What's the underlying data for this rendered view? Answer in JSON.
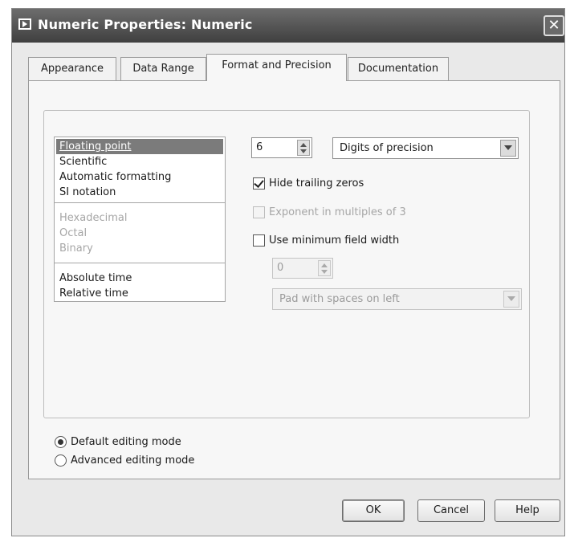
{
  "window": {
    "title": "Numeric Properties: Numeric",
    "close_glyph": "✕"
  },
  "tabs": [
    {
      "label": "Appearance"
    },
    {
      "label": "Data Range"
    },
    {
      "label": "Format and Precision",
      "active": true
    },
    {
      "label": "Documentation"
    }
  ],
  "format_list": {
    "selected": "Floating point",
    "group1": [
      "Floating point",
      "Scientific",
      "Automatic formatting",
      "SI notation"
    ],
    "group2_disabled": [
      "Hexadecimal",
      "Octal",
      "Binary"
    ],
    "group3": [
      "Absolute time",
      "Relative time"
    ]
  },
  "precision": {
    "digits_value": "6",
    "type_selected": "Digits of precision"
  },
  "options": {
    "hide_trailing_zeros": {
      "label": "Hide trailing zeros",
      "checked": true
    },
    "exponent_multiples_3": {
      "label": "Exponent in multiples of 3",
      "checked": false,
      "disabled": true
    },
    "use_min_field_width": {
      "label": "Use minimum field width",
      "checked": false
    },
    "min_width_value": "0",
    "padding_selected": "Pad with spaces on left"
  },
  "editing_mode": {
    "default_label": "Default editing mode",
    "advanced_label": "Advanced editing mode",
    "selected": "default"
  },
  "buttons": {
    "ok": "OK",
    "cancel": "Cancel",
    "help": "Help"
  }
}
